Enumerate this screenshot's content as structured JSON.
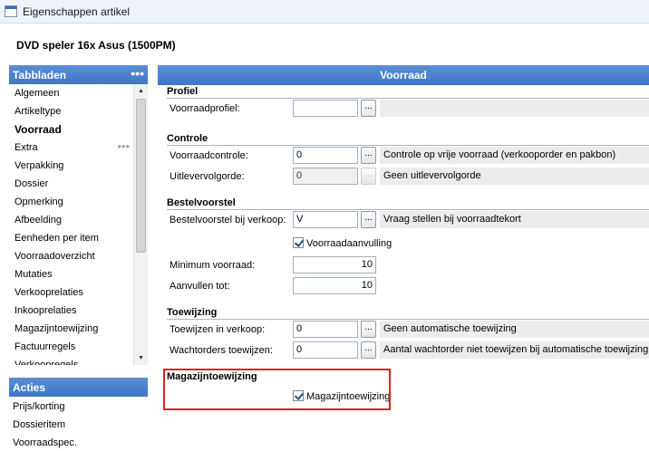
{
  "window": {
    "title": "Eigenschappen artikel"
  },
  "article": {
    "title": "DVD speler 16x Asus (1500PM)"
  },
  "tabs": {
    "header": "Tabbladen",
    "more": "•••",
    "items": [
      {
        "label": "Algemeen"
      },
      {
        "label": "Artikeltype"
      },
      {
        "label": "Voorraad"
      },
      {
        "label": "Extra",
        "dots": "•••"
      },
      {
        "label": "Verpakking"
      },
      {
        "label": "Dossier"
      },
      {
        "label": "Opmerking"
      },
      {
        "label": "Afbeelding"
      },
      {
        "label": "Eenheden per item"
      },
      {
        "label": "Voorraadoverzicht"
      },
      {
        "label": "Mutaties"
      },
      {
        "label": "Verkooprelaties"
      },
      {
        "label": "Inkooprelaties"
      },
      {
        "label": "Magazijntoewijzing"
      },
      {
        "label": "Factuurregels"
      },
      {
        "label": "Verkoopregels"
      }
    ],
    "selected_index": 2
  },
  "actions": {
    "header": "Acties",
    "items": [
      {
        "label": "Prijs/korting"
      },
      {
        "label": "Dossieritem"
      },
      {
        "label": "Voorraadspec."
      }
    ]
  },
  "main": {
    "header": "Voorraad",
    "profiel": {
      "title": "Profiel",
      "voorraadprofiel_label": "Voorraadprofiel:",
      "voorraadprofiel_value": ""
    },
    "controle": {
      "title": "Controle",
      "voorraadcontrole_label": "Voorraadcontrole:",
      "voorraadcontrole_value": "0",
      "voorraadcontrole_desc": "Controle op vrije voorraad (verkooporder en pakbon)",
      "uitlevervolgorde_label": "Uitlevervolgorde:",
      "uitlevervolgorde_value": "0",
      "uitlevervolgorde_desc": "Geen uitlevervolgorde"
    },
    "bestelvoorstel": {
      "title": "Bestelvoorstel",
      "bij_verkoop_label": "Bestelvoorstel bij verkoop:",
      "bij_verkoop_value": "V",
      "bij_verkoop_desc": "Vraag stellen bij voorraadtekort",
      "aanvulling_label": "Voorraadaanvulling",
      "aanvulling_checked": true,
      "minimum_label": "Minimum voorraad:",
      "minimum_value": "10",
      "aanvullen_label": "Aanvullen tot:",
      "aanvullen_value": "10"
    },
    "toewijzing": {
      "title": "Toewijzing",
      "verkoop_label": "Toewijzen in verkoop:",
      "verkoop_value": "0",
      "verkoop_desc": "Geen automatische toewijzing",
      "wachtorders_label": "Wachtorders toewijzen:",
      "wachtorders_value": "0",
      "wachtorders_desc": "Aantal wachtorder niet toewijzen bij automatische toewijzing"
    },
    "magazijn": {
      "title": "Magazijntoewijzing",
      "checkbox_label": "Magazijntoewijzing",
      "checked": true
    },
    "browse_label": "..."
  },
  "colors": {
    "accent": "#4a82cc",
    "highlight": "#e02020"
  }
}
